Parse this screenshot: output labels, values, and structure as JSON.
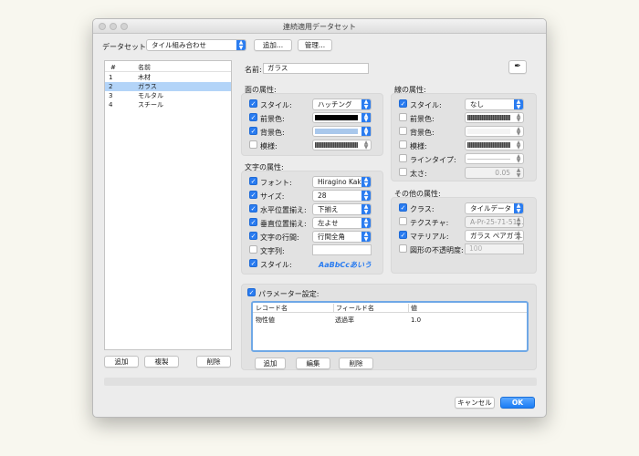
{
  "window": {
    "title": "連続適用データセット"
  },
  "dataset": {
    "label": "データセット:",
    "value": "タイル組み合わせ",
    "add_button": "追加...",
    "manage_button": "管理..."
  },
  "list": {
    "col_num": "#",
    "col_name": "名前",
    "rows": [
      {
        "num": "1",
        "name": "木材"
      },
      {
        "num": "2",
        "name": "ガラス"
      },
      {
        "num": "3",
        "name": "モルタル"
      },
      {
        "num": "4",
        "name": "スチール"
      }
    ],
    "selected_index": 1,
    "add": "追加",
    "duplicate": "複製",
    "delete": "削除"
  },
  "name_field": {
    "label": "名前:",
    "value": "ガラス"
  },
  "face": {
    "title": "面の属性:",
    "style": {
      "label": "スタイル:",
      "value": "ハッチング"
    },
    "fg": {
      "label": "前景色:",
      "color": "#000000"
    },
    "bg": {
      "label": "背景色:",
      "color": "#a9c8ec"
    },
    "pattern": {
      "label": "模様:"
    }
  },
  "line": {
    "title": "線の属性:",
    "style": {
      "label": "スタイル:",
      "value": "なし"
    },
    "fg": {
      "label": "前景色:"
    },
    "bg": {
      "label": "背景色:"
    },
    "pattern": {
      "label": "模様:"
    },
    "linetype": {
      "label": "ラインタイプ:"
    },
    "thickness": {
      "label": "太さ:",
      "value": "0.05"
    }
  },
  "text": {
    "title": "文字の属性:",
    "font": {
      "label": "フォント:",
      "value": "Hiragino Kak..."
    },
    "size": {
      "label": "サイズ:",
      "value": "28"
    },
    "halign": {
      "label": "水平位置揃え:",
      "value": "下揃え"
    },
    "valign": {
      "label": "垂直位置揃え:",
      "value": "左よせ"
    },
    "linespacing": {
      "label": "文字の行間:",
      "value": "行間全角"
    },
    "string": {
      "label": "文字列:"
    },
    "style": {
      "label": "スタイル:",
      "sample": "AaBbCcあいう"
    }
  },
  "other": {
    "title": "その他の属性:",
    "class": {
      "label": "クラス:",
      "value": "タイルデータ"
    },
    "texture": {
      "label": "テクスチャ:",
      "value": "A-Pr-25-71-51..."
    },
    "material": {
      "label": "マテリアル:",
      "value": "ガラス ペアガラ..."
    },
    "opacity": {
      "label": "図形の不透明度:",
      "value": "100"
    }
  },
  "params": {
    "title": "パラメーター設定:",
    "columns": [
      "レコード名",
      "フィールド名",
      "値"
    ],
    "rows": [
      {
        "record": "物性値",
        "field": "透過率",
        "value": "1.0"
      }
    ],
    "add": "追加",
    "edit": "編集",
    "delete": "削除"
  },
  "footer": {
    "cancel": "キャンセル",
    "ok": "OK"
  },
  "colors": {
    "accent": "#2a7cf0",
    "selection": "#b3d4f8"
  },
  "icons": {
    "eyedropper": "eyedropper-icon"
  }
}
